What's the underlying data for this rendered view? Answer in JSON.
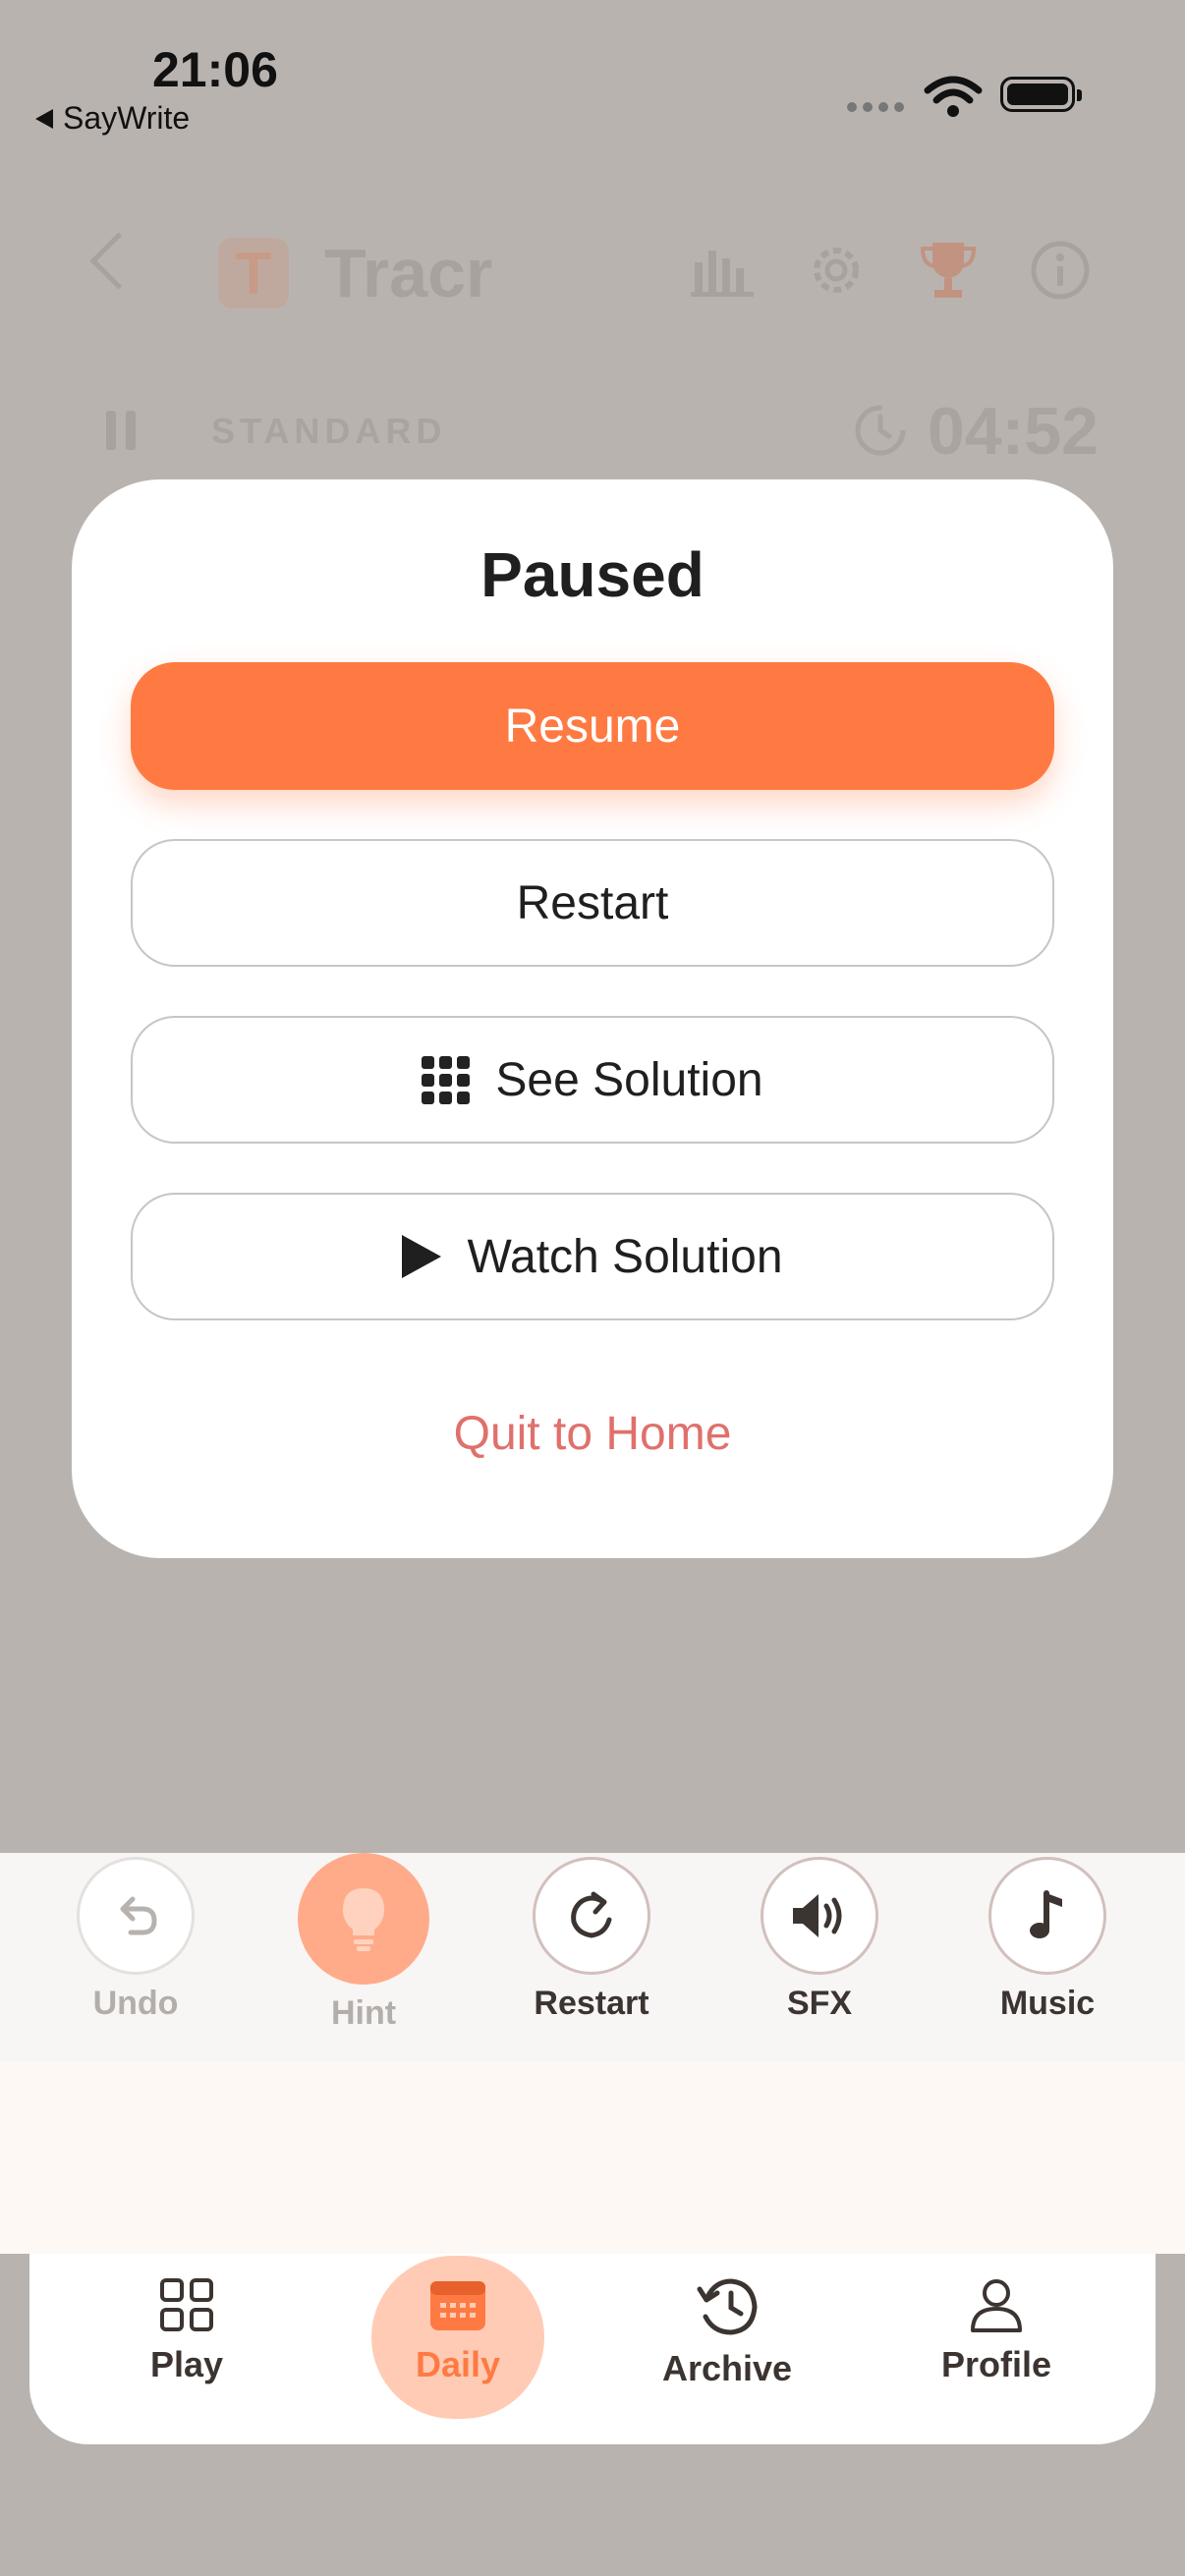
{
  "status_bar": {
    "time": "21:06",
    "back_app": "SayWrite"
  },
  "header": {
    "logo_letter": "T",
    "app_title": "Tracr",
    "icons": [
      "stats-icon",
      "gear-icon",
      "trophy-icon",
      "info-icon"
    ]
  },
  "game_info": {
    "mode": "STANDARD",
    "timer": "04:52"
  },
  "modal": {
    "title": "Paused",
    "resume": "Resume",
    "restart": "Restart",
    "see_solution": "See Solution",
    "watch_solution": "Watch Solution",
    "quit": "Quit to Home"
  },
  "toolbar": {
    "undo": "Undo",
    "hint": "Hint",
    "restart": "Restart",
    "sfx": "SFX",
    "music": "Music"
  },
  "nav": {
    "play": "Play",
    "daily": "Daily",
    "archive": "Archive",
    "profile": "Profile"
  },
  "colors": {
    "accent": "#ff7a43",
    "quit": "#e0706c",
    "overlay": "#b9b3b0"
  }
}
